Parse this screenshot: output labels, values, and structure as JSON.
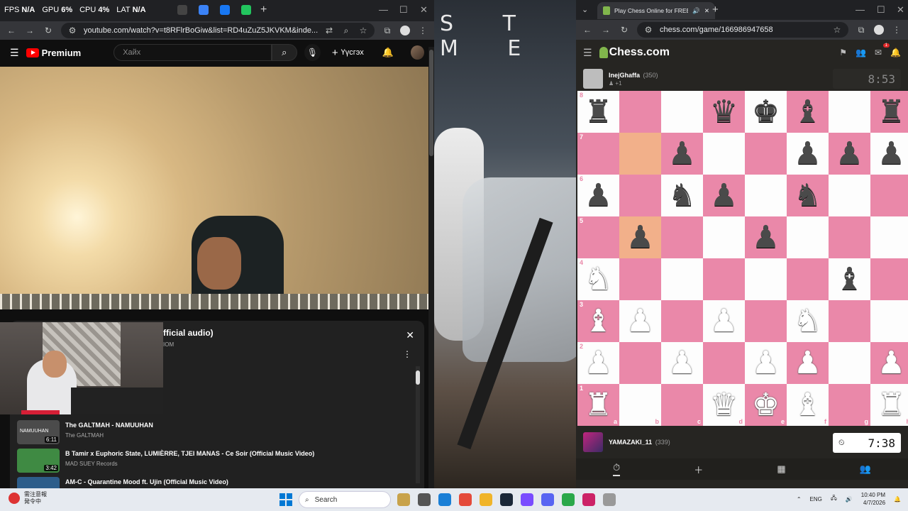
{
  "left_browser": {
    "overlay": [
      {
        "label": "FPS",
        "value": "N/A"
      },
      {
        "label": "GPU",
        "value": "6%"
      },
      {
        "label": "CPU",
        "value": "4%"
      },
      {
        "label": "LAT",
        "value": "N/A"
      }
    ],
    "new_tab": "+",
    "url": "youtube.com/watch?v=t8RFlrBoGiw&list=RD4uZuZ5JKVKM&inde...",
    "youtube": {
      "logo_text": "Premium",
      "search_placeholder": "Хайх",
      "create_label": "Үүсгэх"
    },
    "panel": {
      "title": "fficial audio)",
      "subtitle": "IOM"
    },
    "playlist": [
      {
        "title": "The GALTMAH - NAMUUHAN",
        "channel": "The GALTMAH",
        "duration": "6:11",
        "thumb_label": "NAMUUHAN",
        "thumb_color": "#4b4b4b"
      },
      {
        "title": "B Tamir x Euphoric State, LUMIÈRRE, TJEI MANAS - Ce Soir (Official Music Video)",
        "channel": "MAD SUEY Records",
        "duration": "3:42",
        "thumb_label": "",
        "thumb_color": "#3f8a43"
      },
      {
        "title": "AM-C - Quarantine Mood ft. Ujin (Official Music Video)",
        "channel": "",
        "duration": "",
        "thumb_label": "",
        "thumb_color": "#2d5d8a"
      }
    ]
  },
  "wallpaper": {
    "text": "S T M E"
  },
  "right_browser": {
    "tab_title": "Play Chess Online for FREE",
    "url": "chess.com/game/166986947658",
    "logo_text": "Chess.com",
    "notification_count": "1",
    "opponent": {
      "name": "InejGhaffa",
      "rating": "(350)",
      "extra": "♟ +1",
      "clock": "8:53"
    },
    "player": {
      "name": "YAMAZAKI_11",
      "rating": "(339)",
      "clock": "7:38"
    },
    "board": {
      "light_color": "#fdfdfd",
      "dark_color": "#ea88a9",
      "highlight_color": "#f2b08a",
      "highlight_squares": [
        "b7",
        "b5"
      ],
      "ranks": [
        "8",
        "7",
        "6",
        "5",
        "4",
        "3",
        "2",
        "1"
      ],
      "files": [
        "a",
        "b",
        "c",
        "d",
        "e",
        "f",
        "g",
        "h"
      ],
      "position": [
        [
          "r",
          "",
          "",
          "q",
          "k",
          "b",
          "",
          "r"
        ],
        [
          "",
          "",
          "p",
          "",
          "",
          "p",
          "p",
          "p"
        ],
        [
          "p",
          "",
          "n",
          "p",
          "",
          "n",
          "",
          ""
        ],
        [
          "",
          "p",
          "",
          "",
          "p",
          "",
          "",
          ""
        ],
        [
          "N",
          "",
          "",
          "",
          "",
          "",
          "b",
          ""
        ],
        [
          "B",
          "P",
          "",
          "P",
          "",
          "N",
          "",
          ""
        ],
        [
          "P",
          "",
          "P",
          "",
          "P",
          "P",
          "",
          "P"
        ],
        [
          "R",
          "",
          "",
          "Q",
          "K",
          "B",
          "",
          "R"
        ]
      ]
    },
    "bottom_nav": [
      "⏱",
      "＋",
      "▦",
      "👥"
    ]
  },
  "taskbar": {
    "news_line1": "需注意報",
    "news_line2": "発令中",
    "search_label": "Search",
    "lang": "ENG",
    "time": "10:40 PM",
    "date": "4/7/2026",
    "app_colors": [
      "#c8a24a",
      "#555",
      "#1a7fd6",
      "#e44a3a",
      "#f0b429",
      "#1b2838",
      "#7a4cff",
      "#5865f2",
      "#2ba84a",
      "#cc2266",
      "#999"
    ]
  }
}
